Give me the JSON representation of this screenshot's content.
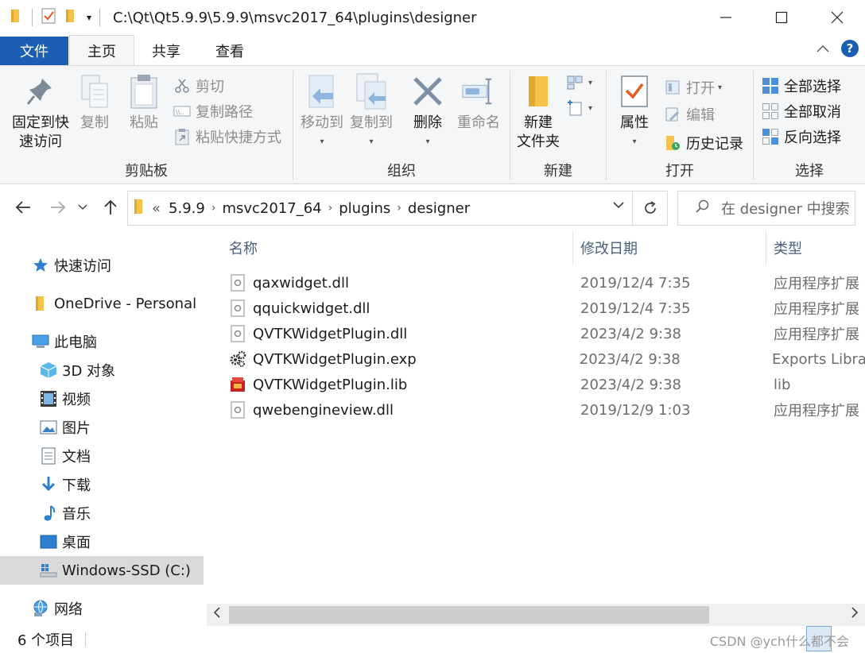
{
  "window": {
    "title": "C:\\Qt\\Qt5.9.9\\5.9.9\\msvc2017_64\\plugins\\designer"
  },
  "tabs": {
    "file": "文件",
    "home": "主页",
    "share": "共享",
    "view": "查看"
  },
  "ribbon": {
    "clipboard": {
      "label": "剪贴板",
      "pin_line1": "固定到快",
      "pin_line2": "速访问",
      "copy": "复制",
      "paste": "粘贴",
      "cut": "剪切",
      "copy_path": "复制路径",
      "paste_shortcut": "粘贴快捷方式"
    },
    "organize": {
      "label": "组织",
      "move_to": "移动到",
      "copy_to": "复制到",
      "delete": "删除",
      "rename": "重命名"
    },
    "new": {
      "label": "新建",
      "new_folder_line1": "新建",
      "new_folder_line2": "文件夹"
    },
    "open": {
      "label": "打开",
      "properties": "属性",
      "open": "打开",
      "edit": "编辑",
      "history": "历史记录"
    },
    "select": {
      "label": "选择",
      "select_all": "全部选择",
      "select_none": "全部取消",
      "invert": "反向选择"
    }
  },
  "address": {
    "overflow": "«",
    "crumbs": [
      "5.9.9",
      "msvc2017_64",
      "plugins",
      "designer"
    ],
    "search_placeholder": "在 designer 中搜索"
  },
  "nav": {
    "items": [
      {
        "label": "快速访问",
        "icon": "star-icon"
      },
      {
        "label": "OneDrive - Personal",
        "icon": "folder-icon"
      },
      {
        "label": "此电脑",
        "icon": "computer-icon"
      },
      {
        "label": "3D 对象",
        "icon": "cube-icon"
      },
      {
        "label": "视频",
        "icon": "film-icon"
      },
      {
        "label": "图片",
        "icon": "picture-icon"
      },
      {
        "label": "文档",
        "icon": "document-icon"
      },
      {
        "label": "下载",
        "icon": "download-icon"
      },
      {
        "label": "音乐",
        "icon": "music-icon"
      },
      {
        "label": "桌面",
        "icon": "desktop-icon"
      },
      {
        "label": "Windows-SSD (C:)",
        "icon": "drive-icon"
      },
      {
        "label": "网络",
        "icon": "network-icon"
      }
    ]
  },
  "columns": {
    "name": "名称",
    "date": "修改日期",
    "type": "类型"
  },
  "files": [
    {
      "name": "qaxwidget.dll",
      "date": "2019/12/4 7:35",
      "type": "应用程序扩展",
      "icon": "dll-icon"
    },
    {
      "name": "qquickwidget.dll",
      "date": "2019/12/4 7:35",
      "type": "应用程序扩展",
      "icon": "dll-icon"
    },
    {
      "name": "QVTKWidgetPlugin.dll",
      "date": "2023/4/2 9:38",
      "type": "应用程序扩展",
      "icon": "dll-icon"
    },
    {
      "name": "QVTKWidgetPlugin.exp",
      "date": "2023/4/2 9:38",
      "type": "Exports Library",
      "icon": "gear-file-icon"
    },
    {
      "name": "QVTKWidgetPlugin.lib",
      "date": "2023/4/2 9:38",
      "type": "lib",
      "icon": "lib-icon"
    },
    {
      "name": "qwebengineview.dll",
      "date": "2019/12/9 1:03",
      "type": "应用程序扩展",
      "icon": "dll-icon"
    }
  ],
  "status": {
    "count": "6 个项目",
    "watermark": "CSDN @ych什么都不会"
  },
  "colors": {
    "accent": "#1a5fb4",
    "folder": "#f6c34a"
  }
}
